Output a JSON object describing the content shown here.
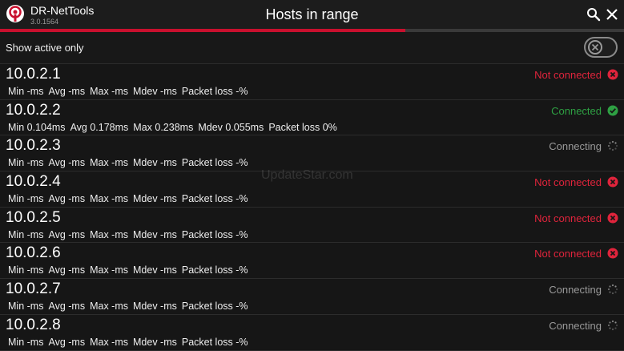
{
  "app": {
    "name": "DR-NetTools",
    "version": "3.0.1564",
    "title": "Hosts in range"
  },
  "progress": {
    "fraction": 0.65
  },
  "filter": {
    "label": "Show active only",
    "enabled": false
  },
  "watermark": "UpdateStar.com",
  "hosts": [
    {
      "ip": "10.0.2.1",
      "status": "Not connected",
      "state": "nc",
      "min": "Min -ms",
      "avg": "Avg -ms",
      "max": "Max -ms",
      "mdev": "Mdev -ms",
      "loss": "Packet loss -%"
    },
    {
      "ip": "10.0.2.2",
      "status": "Connected",
      "state": "ok",
      "min": "Min 0.104ms",
      "avg": "Avg 0.178ms",
      "max": "Max 0.238ms",
      "mdev": "Mdev 0.055ms",
      "loss": "Packet loss 0%"
    },
    {
      "ip": "10.0.2.3",
      "status": "Connecting",
      "state": "cg",
      "min": "Min -ms",
      "avg": "Avg -ms",
      "max": "Max -ms",
      "mdev": "Mdev -ms",
      "loss": "Packet loss -%"
    },
    {
      "ip": "10.0.2.4",
      "status": "Not connected",
      "state": "nc",
      "min": "Min -ms",
      "avg": "Avg -ms",
      "max": "Max -ms",
      "mdev": "Mdev -ms",
      "loss": "Packet loss -%"
    },
    {
      "ip": "10.0.2.5",
      "status": "Not connected",
      "state": "nc",
      "min": "Min -ms",
      "avg": "Avg -ms",
      "max": "Max -ms",
      "mdev": "Mdev -ms",
      "loss": "Packet loss -%"
    },
    {
      "ip": "10.0.2.6",
      "status": "Not connected",
      "state": "nc",
      "min": "Min -ms",
      "avg": "Avg -ms",
      "max": "Max -ms",
      "mdev": "Mdev -ms",
      "loss": "Packet loss -%"
    },
    {
      "ip": "10.0.2.7",
      "status": "Connecting",
      "state": "cg",
      "min": "Min -ms",
      "avg": "Avg -ms",
      "max": "Max -ms",
      "mdev": "Mdev -ms",
      "loss": "Packet loss -%"
    },
    {
      "ip": "10.0.2.8",
      "status": "Connecting",
      "state": "cg",
      "min": "Min -ms",
      "avg": "Avg -ms",
      "max": "Max -ms",
      "mdev": "Mdev -ms",
      "loss": "Packet loss -%"
    }
  ],
  "colors": {
    "accent": "#c8102e",
    "not_connected": "#e0243c",
    "connected": "#2ea043",
    "connecting": "#9a9a9a"
  }
}
